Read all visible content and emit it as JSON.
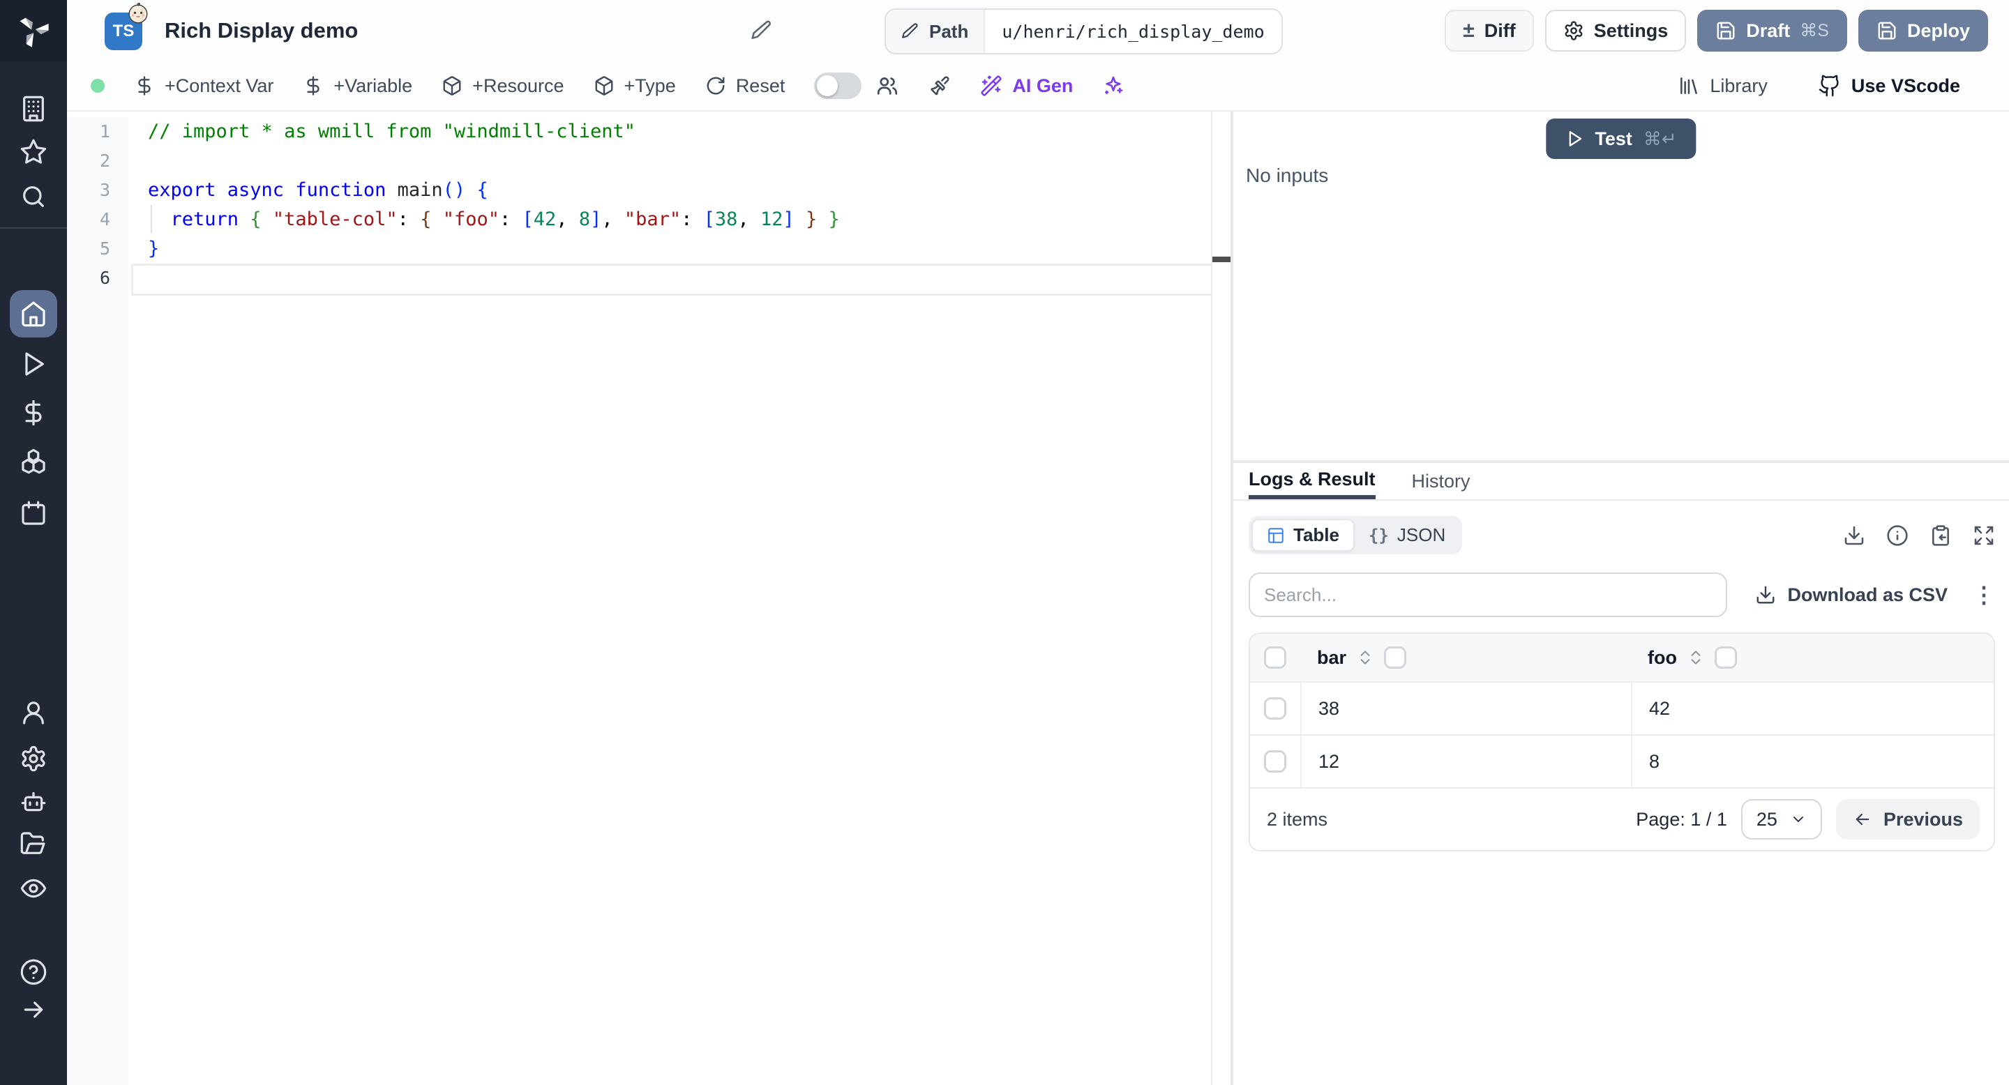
{
  "header": {
    "title": "Rich Display demo",
    "language_badge": "TS",
    "path_label": "Path",
    "path_value": "u/henri/rich_display_demo",
    "diff_label": "Diff",
    "diff_icon": "±",
    "settings_label": "Settings",
    "draft_label": "Draft",
    "draft_shortcut": "⌘S",
    "deploy_label": "Deploy"
  },
  "toolbar": {
    "context_var": "+Context Var",
    "variable": "+Variable",
    "resource": "+Resource",
    "type": "+Type",
    "reset": "Reset",
    "ai_gen": "AI Gen",
    "library": "Library",
    "use_vscode": "Use VScode"
  },
  "editor": {
    "line_numbers": [
      "1",
      "2",
      "3",
      "4",
      "5",
      "6"
    ],
    "active_line": 6,
    "token_colors": {
      "comment": "#008000",
      "kw": "#0000ff",
      "fn": "#262626",
      "str": "#a31515",
      "num": "#098658",
      "plain": "#000000",
      "b1": "#0431fa",
      "b2": "#319331",
      "b3": "#7b3814"
    },
    "lines": [
      [
        {
          "c": "comment",
          "t": "// import * as wmill from \"windmill-client\""
        }
      ],
      [],
      [
        {
          "c": "kw",
          "t": "export async function "
        },
        {
          "c": "fn",
          "t": "main"
        },
        {
          "c": "b1",
          "t": "()"
        },
        {
          "c": "plain",
          "t": " "
        },
        {
          "c": "b1",
          "t": "{"
        }
      ],
      [
        {
          "c": "plain",
          "t": "  "
        },
        {
          "c": "kw",
          "t": "return"
        },
        {
          "c": "plain",
          "t": " "
        },
        {
          "c": "b2",
          "t": "{"
        },
        {
          "c": "plain",
          "t": " "
        },
        {
          "c": "str",
          "t": "\"table-col\""
        },
        {
          "c": "plain",
          "t": ": "
        },
        {
          "c": "b3",
          "t": "{"
        },
        {
          "c": "plain",
          "t": " "
        },
        {
          "c": "str",
          "t": "\"foo\""
        },
        {
          "c": "plain",
          "t": ": "
        },
        {
          "c": "b1",
          "t": "["
        },
        {
          "c": "num",
          "t": "42"
        },
        {
          "c": "plain",
          "t": ", "
        },
        {
          "c": "num",
          "t": "8"
        },
        {
          "c": "b1",
          "t": "]"
        },
        {
          "c": "plain",
          "t": ", "
        },
        {
          "c": "str",
          "t": "\"bar\""
        },
        {
          "c": "plain",
          "t": ": "
        },
        {
          "c": "b1",
          "t": "["
        },
        {
          "c": "num",
          "t": "38"
        },
        {
          "c": "plain",
          "t": ", "
        },
        {
          "c": "num",
          "t": "12"
        },
        {
          "c": "b1",
          "t": "]"
        },
        {
          "c": "plain",
          "t": " "
        },
        {
          "c": "b3",
          "t": "}"
        },
        {
          "c": "plain",
          "t": " "
        },
        {
          "c": "b2",
          "t": "}"
        }
      ],
      [
        {
          "c": "b1",
          "t": "}"
        }
      ],
      []
    ]
  },
  "run_panel": {
    "test_label": "Test",
    "test_shortcut": "⌘↵",
    "no_inputs": "No inputs",
    "tab_logs": "Logs & Result",
    "tab_history": "History",
    "view_table": "Table",
    "view_json": "JSON",
    "braces_icon": "{}",
    "search_placeholder": "Search...",
    "download_csv": "Download as CSV",
    "kebab_icon": "⋮"
  },
  "result_table": {
    "columns": [
      "bar",
      "foo"
    ],
    "rows": [
      [
        "38",
        "42"
      ],
      [
        "12",
        "8"
      ]
    ],
    "items_label": "2 items",
    "page_label": "Page: 1 / 1",
    "page_size": "25",
    "previous_label": "Previous"
  },
  "colors": {
    "sidebar_bg": "#212734",
    "sidebar_active_bg": "#5d6f92",
    "ts_badge_blue": "#3178c6",
    "slate_button": "#6b7e9d",
    "test_button": "#3f5069",
    "ai_purple": "#7c3aed",
    "status_dot_green": "#7fe0a7",
    "table_icon_blue": "#3b82f6"
  }
}
